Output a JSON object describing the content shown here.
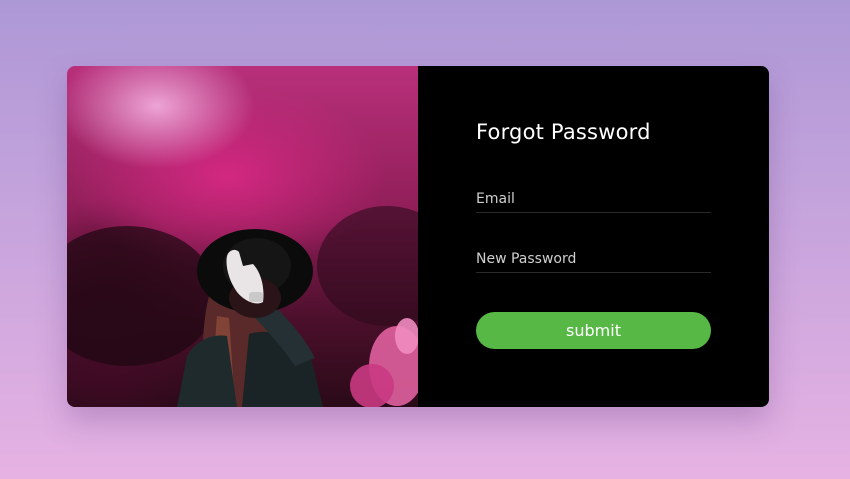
{
  "form": {
    "title": "Forgot Password",
    "email_placeholder": "Email",
    "email_value": "",
    "password_placeholder": "New Password",
    "password_value": "",
    "submit_label": "submit"
  },
  "colors": {
    "page_gradient_top": "#ad98d6",
    "page_gradient_bottom": "#e6b2e3",
    "panel_background": "#000000",
    "button_green": "#57b845",
    "smoke_magenta": "#d62882"
  }
}
